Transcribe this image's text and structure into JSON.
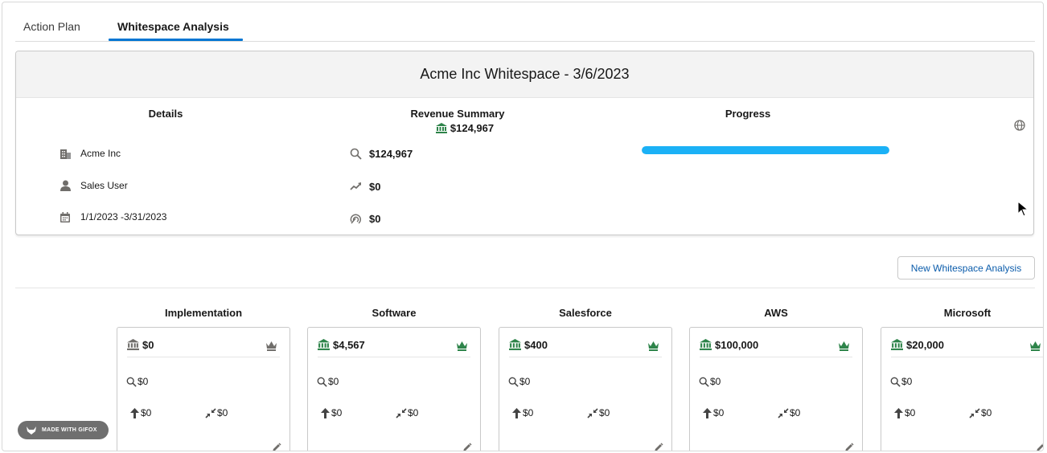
{
  "tabs": [
    {
      "label": "Action Plan",
      "active": false
    },
    {
      "label": "Whitespace Analysis",
      "active": true
    }
  ],
  "summary": {
    "title": "Acme Inc Whitespace - 3/6/2023",
    "details_title": "Details",
    "revenue_title": "Revenue Summary",
    "revenue_total": "$124,967",
    "progress_title": "Progress",
    "progress_fraction": 1.0,
    "details": {
      "account": "Acme Inc",
      "user": "Sales User",
      "dates": "1/1/2023 -3/31/2023"
    },
    "revenue": {
      "pipeline": "$124,967",
      "upsell": "$0",
      "crosssell": "$0"
    },
    "icons": [
      "building-icon",
      "user-icon",
      "calendar-icon",
      "bank-icon",
      "search-icon",
      "trend-icon",
      "target-icon",
      "globe-icon"
    ]
  },
  "new_button_label": "New Whitespace Analysis",
  "categories": [
    {
      "name": "Implementation",
      "amount": "$0",
      "pipeline": "$0",
      "up": "$0",
      "cross": "$0",
      "crown_color": "#706e6b"
    },
    {
      "name": "Software",
      "amount": "$4,567",
      "pipeline": "$0",
      "up": "$0",
      "cross": "$0",
      "crown_color": "#2e844a"
    },
    {
      "name": "Salesforce",
      "amount": "$400",
      "pipeline": "$0",
      "up": "$0",
      "cross": "$0",
      "crown_color": "#2e844a"
    },
    {
      "name": "AWS",
      "amount": "$100,000",
      "pipeline": "$0",
      "up": "$0",
      "cross": "$0",
      "crown_color": "#2e844a"
    },
    {
      "name": "Microsoft",
      "amount": "$20,000",
      "pipeline": "$0",
      "up": "$0",
      "cross": "$0",
      "crown_color": "#2e844a"
    }
  ],
  "colors": {
    "accent": "#0176d3",
    "progress": "#1bb1f6",
    "bank_green": "#2e844a",
    "link": "#0b5cab"
  },
  "watermark": "MADE WITH GIFOX"
}
